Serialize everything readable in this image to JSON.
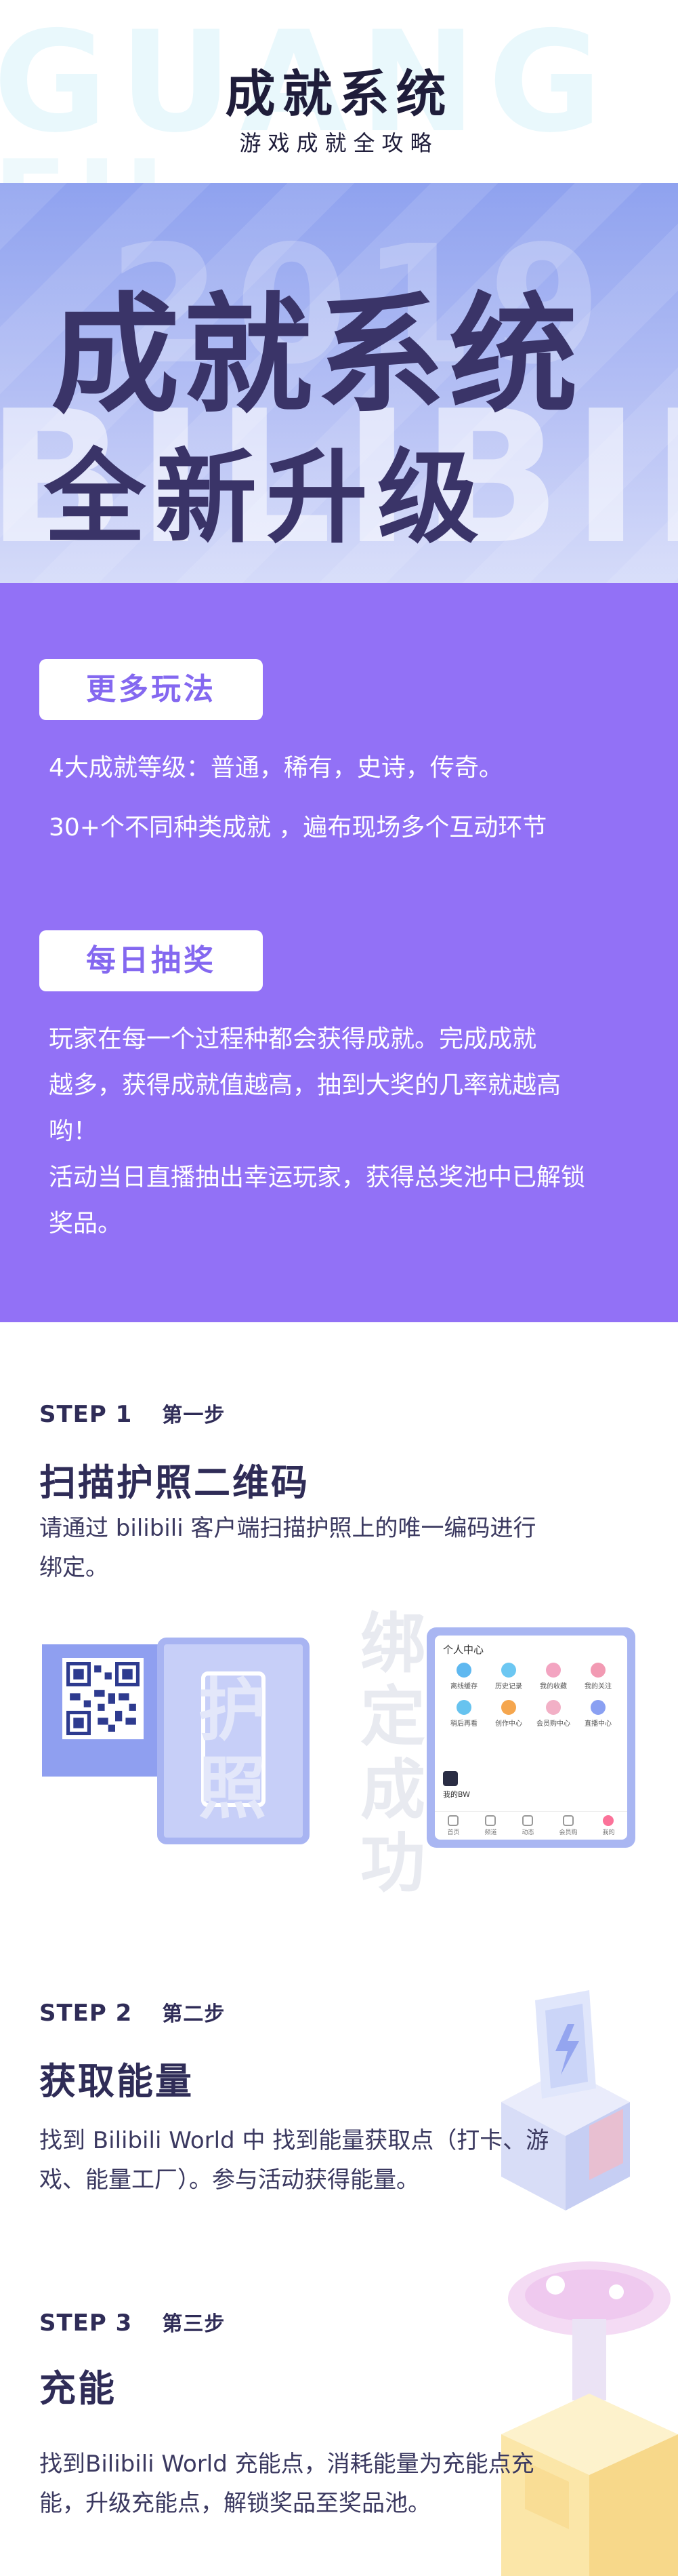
{
  "header": {
    "watermark_top": "GUANG",
    "watermark_bottom": "FU",
    "title": "成就系统",
    "subtitle": "游戏成就全攻略"
  },
  "hero": {
    "watermark_year": "2019",
    "watermark_text": "BILIBILI",
    "line_1": "成就系统",
    "line_2": "全新升级"
  },
  "purple": {
    "section_1": {
      "pill": "更多玩法",
      "lines": [
        "4大成就等级：普通，稀有，史诗，传奇。",
        "30+个不同种类成就 ，遍布现场多个互动环节"
      ]
    },
    "section_2": {
      "pill": "每日抽奖",
      "lines": [
        "玩家在每一个过程种都会获得成就。完成成就",
        "越多，获得成就值越高，抽到大奖的几率就越高",
        "哟！",
        "活动当日直播抽出幸运玩家，获得总奖池中已解锁",
        "奖品。"
      ]
    }
  },
  "steps": [
    {
      "label": "STEP 1",
      "label_cn": "第一步",
      "title": "扫描护照二维码",
      "desc": [
        "请通过 bilibili 客户端扫描护照上的唯一编码进行",
        "绑定。"
      ]
    },
    {
      "label": "STEP 2",
      "label_cn": "第二步",
      "title": "获取能量",
      "desc": [
        "找到 Bilibili World 中 找到能量获取点（打卡、游",
        "戏、能量工厂）。参与活动获得能量。"
      ]
    },
    {
      "label": "STEP 3",
      "label_cn": "第三步",
      "title": "充能",
      "desc": [
        "找到Bilibili World 充能点，消耗能量为充能点充",
        "能，升级充能点，解锁奖品至奖品池。"
      ]
    }
  ],
  "illustration": {
    "scan_chars": [
      "护",
      "照"
    ],
    "bind_chars": [
      "绑",
      "定",
      "成",
      "功"
    ],
    "app": {
      "title": "个人中心",
      "grid": [
        {
          "label": "离线缓存",
          "color": "#5fb8f0"
        },
        {
          "label": "历史记录",
          "color": "#6cc7f2"
        },
        {
          "label": "我的收藏",
          "color": "#f3a4c1"
        },
        {
          "label": "我的关注",
          "color": "#f29ab3"
        },
        {
          "label": "稍后再看",
          "color": "#67c3ef"
        },
        {
          "label": "创作中心",
          "color": "#f5a64e"
        },
        {
          "label": "会员购中心",
          "color": "#f2b0c6"
        },
        {
          "label": "直播中心",
          "color": "#8aa0f2"
        }
      ],
      "note": "我的BW",
      "tabs": [
        "首页",
        "频道",
        "动态",
        "会员购",
        "我的"
      ]
    }
  },
  "colors": {
    "purple_bg": "#9271f6",
    "pill_text": "#8468f0",
    "title_dark": "#1f1d3a",
    "hero_text": "#3a3468"
  }
}
